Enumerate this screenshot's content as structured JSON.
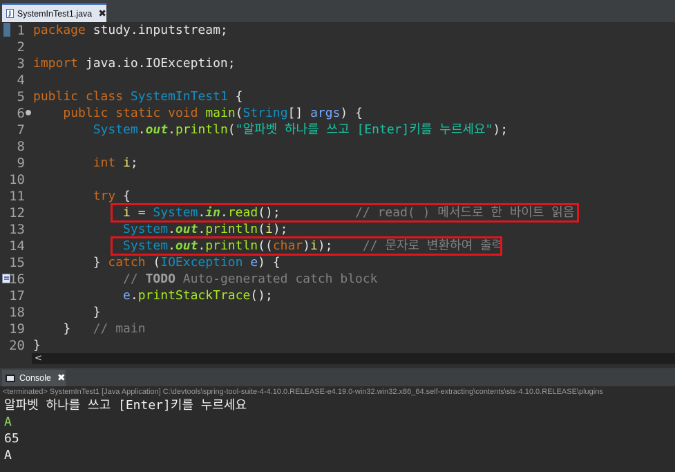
{
  "editor_tab": {
    "icon": "J",
    "title": "SystemInTest1.java",
    "close": "✖"
  },
  "code_lines": [
    {
      "n": "1",
      "tokens": [
        [
          "kw",
          "package"
        ],
        [
          "txt",
          " study.inputstream;"
        ]
      ]
    },
    {
      "n": "2",
      "tokens": []
    },
    {
      "n": "3",
      "tokens": [
        [
          "kw",
          "import"
        ],
        [
          "txt",
          " java.io.IOException;"
        ]
      ]
    },
    {
      "n": "4",
      "tokens": []
    },
    {
      "n": "5",
      "tokens": [
        [
          "kw",
          "public"
        ],
        [
          "txt",
          " "
        ],
        [
          "kw",
          "class"
        ],
        [
          "txt",
          " "
        ],
        [
          "cls",
          "SystemInTest1"
        ],
        [
          "txt",
          " {"
        ]
      ]
    },
    {
      "n": "6",
      "fold": true,
      "tokens": [
        [
          "txt",
          "    "
        ],
        [
          "kw",
          "public"
        ],
        [
          "txt",
          " "
        ],
        [
          "kw",
          "static"
        ],
        [
          "txt",
          " "
        ],
        [
          "kw",
          "void"
        ],
        [
          "txt",
          " "
        ],
        [
          "mtd",
          "main"
        ],
        [
          "txt",
          "("
        ],
        [
          "cls",
          "String"
        ],
        [
          "txt",
          "[] "
        ],
        [
          "par",
          "args"
        ],
        [
          "txt",
          ") {"
        ]
      ]
    },
    {
      "n": "7",
      "tokens": [
        [
          "txt",
          "        "
        ],
        [
          "cls",
          "System"
        ],
        [
          "txt",
          "."
        ],
        [
          "fld",
          "out"
        ],
        [
          "txt",
          "."
        ],
        [
          "mtd",
          "println"
        ],
        [
          "txt",
          "("
        ],
        [
          "str",
          "\"알파벳 하나를 쓰고 [Enter]키를 누르세요\""
        ],
        [
          "txt",
          ");"
        ]
      ]
    },
    {
      "n": "8",
      "tokens": []
    },
    {
      "n": "9",
      "tokens": [
        [
          "txt",
          "        "
        ],
        [
          "kw",
          "int"
        ],
        [
          "txt",
          " "
        ],
        [
          "var",
          "i"
        ],
        [
          "txt",
          ";"
        ]
      ]
    },
    {
      "n": "10",
      "tokens": []
    },
    {
      "n": "11",
      "tokens": [
        [
          "txt",
          "        "
        ],
        [
          "kw",
          "try"
        ],
        [
          "txt",
          " {"
        ]
      ]
    },
    {
      "n": "12",
      "tokens": [
        [
          "txt",
          "            "
        ],
        [
          "var",
          "i"
        ],
        [
          "txt",
          " = "
        ],
        [
          "cls",
          "System"
        ],
        [
          "txt",
          "."
        ],
        [
          "fld",
          "in"
        ],
        [
          "txt",
          "."
        ],
        [
          "mtd",
          "read"
        ],
        [
          "txt",
          "();          "
        ],
        [
          "cmt",
          "// read( ) 메서드로 한 바이트 읽음"
        ]
      ]
    },
    {
      "n": "13",
      "tokens": [
        [
          "txt",
          "            "
        ],
        [
          "cls",
          "System"
        ],
        [
          "txt",
          "."
        ],
        [
          "fld",
          "out"
        ],
        [
          "txt",
          "."
        ],
        [
          "mtd",
          "println"
        ],
        [
          "txt",
          "("
        ],
        [
          "var",
          "i"
        ],
        [
          "txt",
          ");"
        ]
      ]
    },
    {
      "n": "14",
      "tokens": [
        [
          "txt",
          "            "
        ],
        [
          "cls",
          "System"
        ],
        [
          "txt",
          "."
        ],
        [
          "fld",
          "out"
        ],
        [
          "txt",
          "."
        ],
        [
          "mtd",
          "println"
        ],
        [
          "txt",
          "(("
        ],
        [
          "kw",
          "char"
        ],
        [
          "txt",
          ")"
        ],
        [
          "var",
          "i"
        ],
        [
          "txt",
          ");    "
        ],
        [
          "cmt",
          "// 문자로 변환하여 출력"
        ]
      ]
    },
    {
      "n": "15",
      "tokens": [
        [
          "txt",
          "        } "
        ],
        [
          "kw",
          "catch"
        ],
        [
          "txt",
          " ("
        ],
        [
          "cls",
          "IOException"
        ],
        [
          "txt",
          " "
        ],
        [
          "par",
          "e"
        ],
        [
          "txt",
          ") {"
        ]
      ]
    },
    {
      "n": "16",
      "task": true,
      "tokens": [
        [
          "txt",
          "            "
        ],
        [
          "cmt",
          "// "
        ],
        [
          "todo",
          "TODO"
        ],
        [
          "cmt",
          " Auto-generated catch block"
        ]
      ]
    },
    {
      "n": "17",
      "tokens": [
        [
          "txt",
          "            "
        ],
        [
          "par",
          "e"
        ],
        [
          "txt",
          "."
        ],
        [
          "mtd",
          "printStackTrace"
        ],
        [
          "txt",
          "();"
        ]
      ]
    },
    {
      "n": "18",
      "tokens": [
        [
          "txt",
          "        }"
        ]
      ]
    },
    {
      "n": "19",
      "tokens": [
        [
          "txt",
          "    }   "
        ],
        [
          "cmt",
          "// main"
        ]
      ]
    },
    {
      "n": "20",
      "tokens": [
        [
          "txt",
          "}"
        ]
      ]
    }
  ],
  "hscroll_arrow": "<",
  "console": {
    "tab_title": "Console",
    "close": "✖",
    "status": "<terminated> SystemInTest1 [Java Application] C:\\devtools\\spring-tool-suite-4-4.10.0.RELEASE-e4.19.0-win32.win32.x86_64.self-extracting\\contents\\sts-4.10.0.RELEASE\\plugins",
    "output": [
      {
        "text": "알파벳 하나를 쓰고 [Enter]키를 누르세요",
        "kind": "plain"
      },
      {
        "text": "A",
        "kind": "input"
      },
      {
        "text": "65",
        "kind": "plain"
      },
      {
        "text": "A",
        "kind": "plain"
      }
    ]
  },
  "colors": {
    "keyword": "#cc6c1d",
    "class": "#1290c3",
    "method": "#a7ec21",
    "string": "#17c6a3",
    "comment": "#808080",
    "highlight_box": "#e0151e"
  }
}
